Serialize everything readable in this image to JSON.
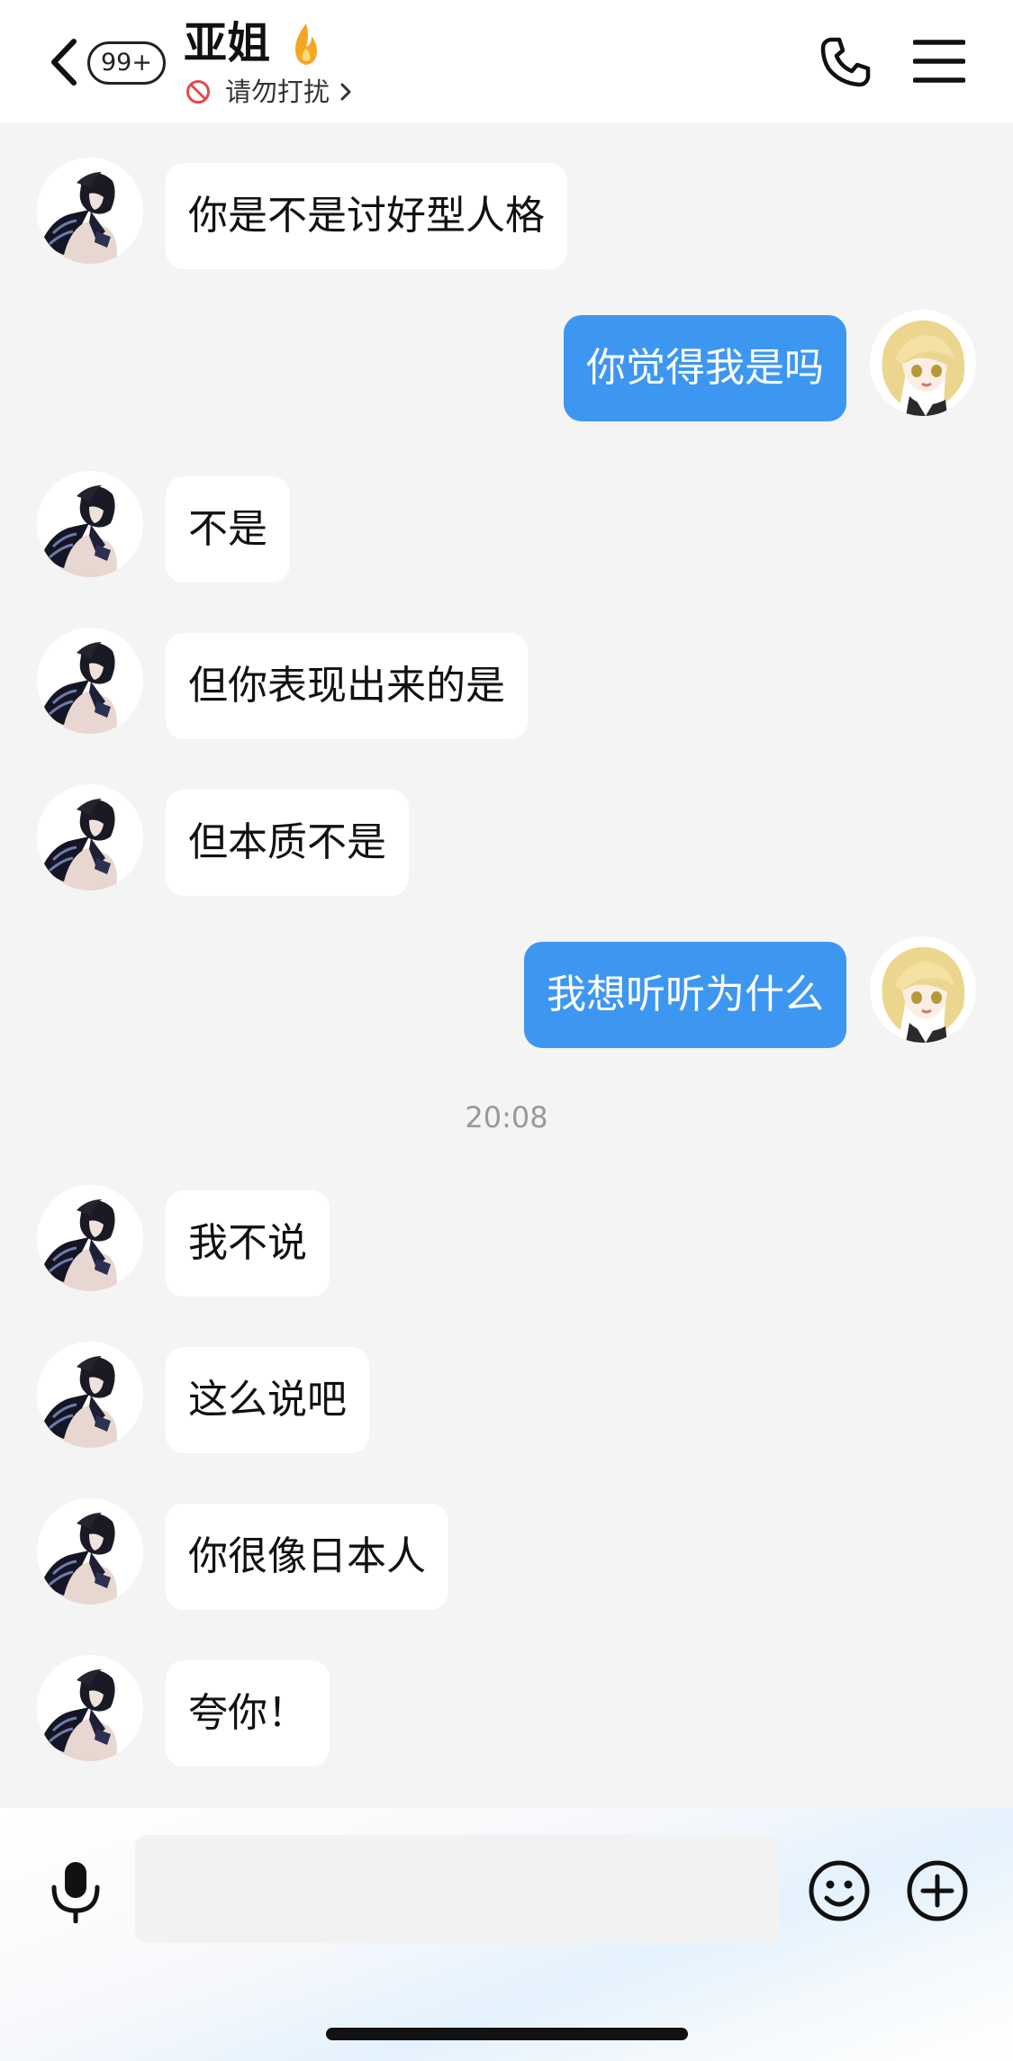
{
  "header": {
    "back_icon": "chevron-left-icon",
    "unread_badge": "99+",
    "contact_name": "亚姐",
    "streak_icon": "flame-icon",
    "status_icon": "no-entry-icon",
    "status_text": "请勿打扰",
    "call_icon": "phone-icon",
    "menu_icon": "hamburger-menu-icon"
  },
  "colors": {
    "outgoing_bubble": "#3d97f0",
    "incoming_bubble": "#ffffff",
    "chat_background": "#f4f4f4",
    "dnd_red": "#e5484d",
    "flame": "#f5a623"
  },
  "messages": [
    {
      "direction": "in",
      "text": "你是不是讨好型人格"
    },
    {
      "direction": "out",
      "text": "你觉得我是吗"
    },
    {
      "direction": "in",
      "text": "不是"
    },
    {
      "direction": "in",
      "text": "但你表现出来的是"
    },
    {
      "direction": "in",
      "text": "但本质不是"
    },
    {
      "direction": "out",
      "text": "我想听听为什么"
    },
    {
      "direction": "in",
      "text": "我不说"
    },
    {
      "direction": "in",
      "text": "这么说吧"
    },
    {
      "direction": "in",
      "text": "你很像日本人"
    },
    {
      "direction": "in",
      "text": "夸你！"
    }
  ],
  "timestamp": "20:08",
  "input_bar": {
    "voice_icon": "microphone-icon",
    "placeholder": "",
    "value": "",
    "emoji_icon": "smiley-face-icon",
    "more_icon": "plus-circle-icon"
  }
}
